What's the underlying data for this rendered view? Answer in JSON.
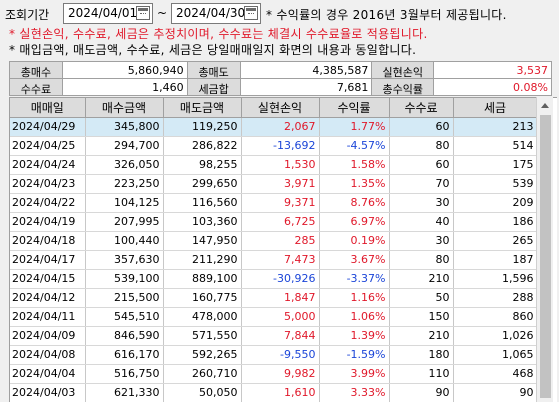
{
  "filter": {
    "period_label": "조회기간",
    "start_date": "2024/04/01",
    "tilde": "~",
    "end_date": "2024/04/30",
    "note_top": "* 수익률의 경우 2016년 3월부터 제공됩니다."
  },
  "notes": {
    "warning": "* 실현손익, 수수료, 세금은 추정치이며, 수수료는 체결시 수수료율로 적용됩니다.",
    "info": "* 매입금액, 매도금액, 수수료, 세금은 당일매매일지 화면의 내용과 동일합니다."
  },
  "summary": {
    "row1": [
      {
        "label": "총매수",
        "value": "5,860,940"
      },
      {
        "label": "총매도",
        "value": "4,385,587"
      },
      {
        "label": "실현손익",
        "value": "3,537"
      }
    ],
    "row2": [
      {
        "label": "수수료",
        "value": "1,460"
      },
      {
        "label": "세금합",
        "value": "7,681"
      },
      {
        "label": "총수익률",
        "value": "0.08%"
      }
    ]
  },
  "table": {
    "headers": [
      "매매일",
      "매수금액",
      "매도금액",
      "실현손익",
      "수익률",
      "수수료",
      "세금"
    ],
    "rows": [
      [
        "2024/04/29",
        "345,800",
        "119,250",
        "2,067",
        "1.77%",
        "60",
        "213"
      ],
      [
        "2024/04/25",
        "294,700",
        "286,822",
        "-13,692",
        "-4.57%",
        "80",
        "514"
      ],
      [
        "2024/04/24",
        "326,050",
        "98,255",
        "1,530",
        "1.58%",
        "60",
        "175"
      ],
      [
        "2024/04/23",
        "223,250",
        "299,650",
        "3,971",
        "1.35%",
        "70",
        "539"
      ],
      [
        "2024/04/22",
        "104,125",
        "116,560",
        "9,371",
        "8.76%",
        "30",
        "209"
      ],
      [
        "2024/04/19",
        "207,995",
        "103,360",
        "6,725",
        "6.97%",
        "40",
        "186"
      ],
      [
        "2024/04/18",
        "100,440",
        "147,950",
        "285",
        "0.19%",
        "30",
        "265"
      ],
      [
        "2024/04/17",
        "357,630",
        "211,290",
        "7,473",
        "3.67%",
        "80",
        "187"
      ],
      [
        "2024/04/15",
        "539,100",
        "889,100",
        "-30,926",
        "-3.37%",
        "210",
        "1,596"
      ],
      [
        "2024/04/12",
        "215,500",
        "160,775",
        "1,847",
        "1.16%",
        "50",
        "288"
      ],
      [
        "2024/04/11",
        "545,510",
        "478,000",
        "5,000",
        "1.06%",
        "150",
        "860"
      ],
      [
        "2024/04/09",
        "846,590",
        "571,550",
        "7,844",
        "1.39%",
        "210",
        "1,026"
      ],
      [
        "2024/04/08",
        "616,170",
        "592,265",
        "-9,550",
        "-1.59%",
        "180",
        "1,065"
      ],
      [
        "2024/04/04",
        "516,750",
        "260,710",
        "9,982",
        "3.99%",
        "110",
        "468"
      ],
      [
        "2024/04/03",
        "621,330",
        "50,050",
        "1,610",
        "3.33%",
        "90",
        "90"
      ]
    ]
  },
  "colors": {
    "profit": "#e0182a",
    "loss": "#1b45d8",
    "selected_row": "#d4eaf6",
    "header_bg": "#dcdcdc"
  },
  "icons": [
    "calendar-icon",
    "scroll-up-arrow-icon"
  ]
}
